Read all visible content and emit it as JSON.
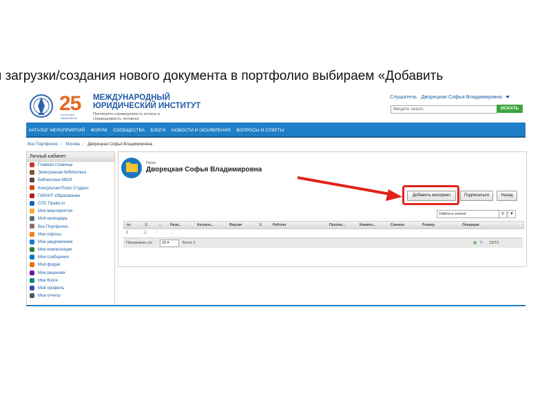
{
  "caption": "я загрузки/создания нового документа в портфолио выбираем «Добавить",
  "header": {
    "logo_number": "25",
    "logo_small": "лет во имя образования",
    "institute_name": "МЕЖДУНАРОДНЫЙ ЮРИДИЧЕСКИЙ ИНСТИТУТ",
    "slogan": "Претворять справедливость истины в справедливость человека",
    "user_role": "Слушатель",
    "user_name": "Дворецкая Софья Владимировна",
    "search_placeholder": "Введите запрос",
    "search_button": "ИСКАТЬ"
  },
  "nav": [
    "КАТАЛОГ МЕРОПРИЯТИЙ",
    "ФОРУМ",
    "СООБЩЕСТВА",
    "БЛОГИ",
    "НОВОСТИ И ОБЪЯВЛЕНИЯ",
    "ВОПРОСЫ И ОТВЕТЫ"
  ],
  "breadcrumb": [
    "Все Портфолио",
    "Москва",
    "Дворецкая Софья Владимировна"
  ],
  "sidebar": {
    "title": "Личный кабинет",
    "items": [
      {
        "label": "Главная страница",
        "icon": "home-icon",
        "color": "#c0392b"
      },
      {
        "label": "Электронная библиотека",
        "icon": "book-icon",
        "color": "#7b5a2a"
      },
      {
        "label": "Библиотека МЮИ",
        "icon": "library-icon",
        "color": "#5d4037"
      },
      {
        "label": "КонсультантПлюс Студент",
        "icon": "consultant-icon",
        "color": "#d84315"
      },
      {
        "label": "ГАРАНТ-Образование",
        "icon": "garant-icon",
        "color": "#b71c1c"
      },
      {
        "label": "СПС Право.ru",
        "icon": "pravo-icon",
        "color": "#1565c0"
      },
      {
        "label": "Мои мероприятия",
        "icon": "events-icon",
        "color": "#f9a825"
      },
      {
        "label": "Мой календарь",
        "icon": "calendar-icon",
        "color": "#546e7a"
      },
      {
        "label": "Все Портфолио",
        "icon": "portfolio-icon",
        "color": "#8d6e63"
      },
      {
        "label": "Мои опросы",
        "icon": "poll-icon",
        "color": "#f57f17"
      },
      {
        "label": "Мои уведомления",
        "icon": "notification-icon",
        "color": "#1976d2"
      },
      {
        "label": "Мои компетенции",
        "icon": "competence-icon",
        "color": "#2e7d32"
      },
      {
        "label": "Мои сообщения",
        "icon": "messages-icon",
        "color": "#0277bd"
      },
      {
        "label": "Мой форум",
        "icon": "forum-icon",
        "color": "#ef6c00"
      },
      {
        "label": "Мои рецензии",
        "icon": "review-icon",
        "color": "#6a1b9a"
      },
      {
        "label": "Мои блоги",
        "icon": "blog-icon",
        "color": "#00897b"
      },
      {
        "label": "Мой профиль",
        "icon": "profile-icon",
        "color": "#3949ab"
      },
      {
        "label": "Мои отчеты",
        "icon": "report-icon",
        "color": "#455a64"
      }
    ]
  },
  "folder": {
    "type_label": "Папка",
    "title": "Дворецкая Софья Владимировна"
  },
  "buttons": {
    "add": "Добавить материал",
    "subscribe": "Подписаться",
    "back": "Назад"
  },
  "find": {
    "placeholder": "Найти в списке"
  },
  "table": {
    "columns": [
      "№",
      "",
      "...",
      "Назв...",
      "Актуаль...",
      "Версия",
      "",
      "Рейтинг",
      "Просмо...",
      "Коммен...",
      "Скачано",
      "Размер",
      "Операции"
    ],
    "rows": [
      {
        "num": "1",
        "name": ".."
      }
    ]
  },
  "pager": {
    "label": "Показывать по",
    "per_page": "20",
    "total": "Всего 1",
    "range": "13/13"
  }
}
